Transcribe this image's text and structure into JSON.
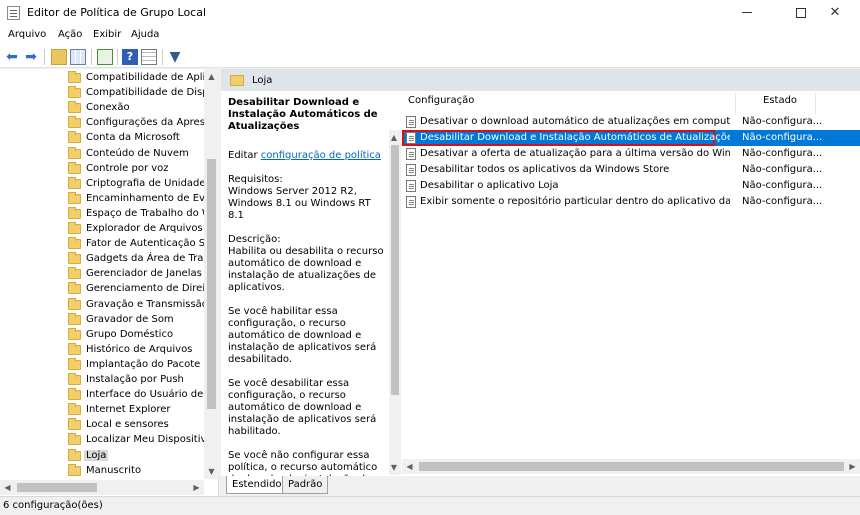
{
  "window": {
    "title": "Editor de Política de Grupo Local"
  },
  "menu": {
    "items": [
      "Arquivo",
      "Ação",
      "Exibir",
      "Ajuda"
    ]
  },
  "toolbar": {
    "icons": [
      "back-arrow-icon",
      "forward-arrow-icon",
      "folder-up-icon",
      "show-hide-tree-icon",
      "export-list-icon",
      "help-icon",
      "properties-icon",
      "filter-icon"
    ]
  },
  "tree": {
    "items": [
      {
        "label": "Compatibilidade de Aplica"
      },
      {
        "label": "Compatibilidade de Dispos"
      },
      {
        "label": "Conexão"
      },
      {
        "label": "Configurações da Apresent"
      },
      {
        "label": "Conta da Microsoft"
      },
      {
        "label": "Conteúdo de Nuvem"
      },
      {
        "label": "Controle por voz"
      },
      {
        "label": "Criptografia de Unidade de"
      },
      {
        "label": "Encaminhamento de Event"
      },
      {
        "label": "Espaço de Trabalho do Wir"
      },
      {
        "label": "Explorador de Arquivos"
      },
      {
        "label": "Fator de Autenticação Secu"
      },
      {
        "label": "Gadgets da Área de Traball"
      },
      {
        "label": "Gerenciador de Janelas da ."
      },
      {
        "label": "Gerenciamento de Direitos"
      },
      {
        "label": "Gravação e Transmissão de"
      },
      {
        "label": "Gravador de Som"
      },
      {
        "label": "Grupo Doméstico"
      },
      {
        "label": "Histórico de Arquivos"
      },
      {
        "label": "Implantação do Pacote de"
      },
      {
        "label": "Instalação por Push"
      },
      {
        "label": "Interface do Usuário de Cre"
      },
      {
        "label": "Internet Explorer"
      },
      {
        "label": "Local e sensores"
      },
      {
        "label": "Localizar Meu Dispositivo"
      },
      {
        "label": "Loja"
      },
      {
        "label": "Manuscrito"
      }
    ],
    "selected_index": 25
  },
  "header": {
    "title": "Loja"
  },
  "description": {
    "setting_title": "Desabilitar Download e Instalação Automáticos de Atualizações",
    "edit_prefix": "Editar ",
    "edit_link": "configuração de política",
    "requirements": "Requisitos:\nWindows Server 2012 R2, Windows 8.1 ou Windows RT 8.1",
    "description": "Descrição:\nHabilita ou desabilita o recurso automático de download e instalação de atualizações de aplicativos.",
    "enabled": "Se você habilitar essa configuração, o recurso automático de download e instalação de aplicativos será desabilitado.",
    "disabled": "Se você desabilitar essa configuração, o recurso automático de download e instalação de aplicativos será habilitado.",
    "not_configured": "Se você não configurar essa política, o recurso automático de download e instalação de"
  },
  "list": {
    "columns": {
      "config": "Configuração",
      "state": "Estado"
    },
    "rows": [
      {
        "name": "Desativar o download automático de atualizações em computadores ...",
        "state": "Não-configura..."
      },
      {
        "name": "Desabilitar Download e Instalação Automáticos de Atualizações",
        "state": "Não-configura..."
      },
      {
        "name": "Desativar a oferta de atualização para a última versão do Windows",
        "state": "Não-configura..."
      },
      {
        "name": "Desabilitar todos os aplicativos da Windows Store",
        "state": "Não-configura..."
      },
      {
        "name": "Desabilitar o aplicativo Loja",
        "state": "Não-configura..."
      },
      {
        "name": "Exibir somente o repositório particular dentro do aplicativo da Windo...",
        "state": "Não-configura..."
      }
    ],
    "selected_index": 1
  },
  "tabs": {
    "extended": "Estendido",
    "standard": "Padrão"
  },
  "status": {
    "text": "6 configuração(ões)"
  },
  "colors": {
    "selection": "#0078d7",
    "highlight_box": "#d0121b",
    "link": "#0066cc",
    "header_band": "#dfe5ea"
  }
}
